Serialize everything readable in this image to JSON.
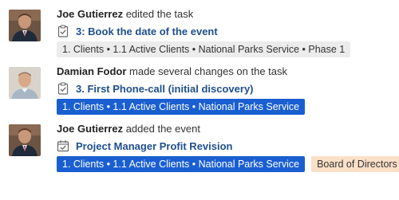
{
  "activity": [
    {
      "actor": "Joe Gutierrez",
      "action": " edited the task",
      "avatar_icon": "person-photo-icon",
      "item_icon": "task-clipboard-icon",
      "item_title": "3: Book the date of the event",
      "tags": [
        {
          "label": "1. Clients • 1.1 Active Clients • National Parks Service • Phase 1",
          "style": "gray"
        }
      ]
    },
    {
      "actor": "Damian Fodor",
      "action": " made several changes on the task",
      "avatar_icon": "person-photo-icon",
      "item_icon": "task-clipboard-icon",
      "item_title": "3. First Phone-call (initial discovery)",
      "tags": [
        {
          "label": "1. Clients • 1.1 Active Clients • National Parks Service",
          "style": "blue"
        }
      ]
    },
    {
      "actor": "Joe Gutierrez",
      "action": " added the event",
      "avatar_icon": "person-photo-icon",
      "item_icon": "calendar-check-icon",
      "item_title": "Project Manager Profit Revision",
      "tags": [
        {
          "label": "1. Clients • 1.1 Active Clients • National Parks Service",
          "style": "blue"
        },
        {
          "label": "Board of Directors",
          "style": "orange"
        }
      ]
    }
  ],
  "colors": {
    "link": "#1f4f8f",
    "tag_blue": "#1a5fd1",
    "tag_gray": "#ececec",
    "tag_orange": "#fbe0c8"
  }
}
